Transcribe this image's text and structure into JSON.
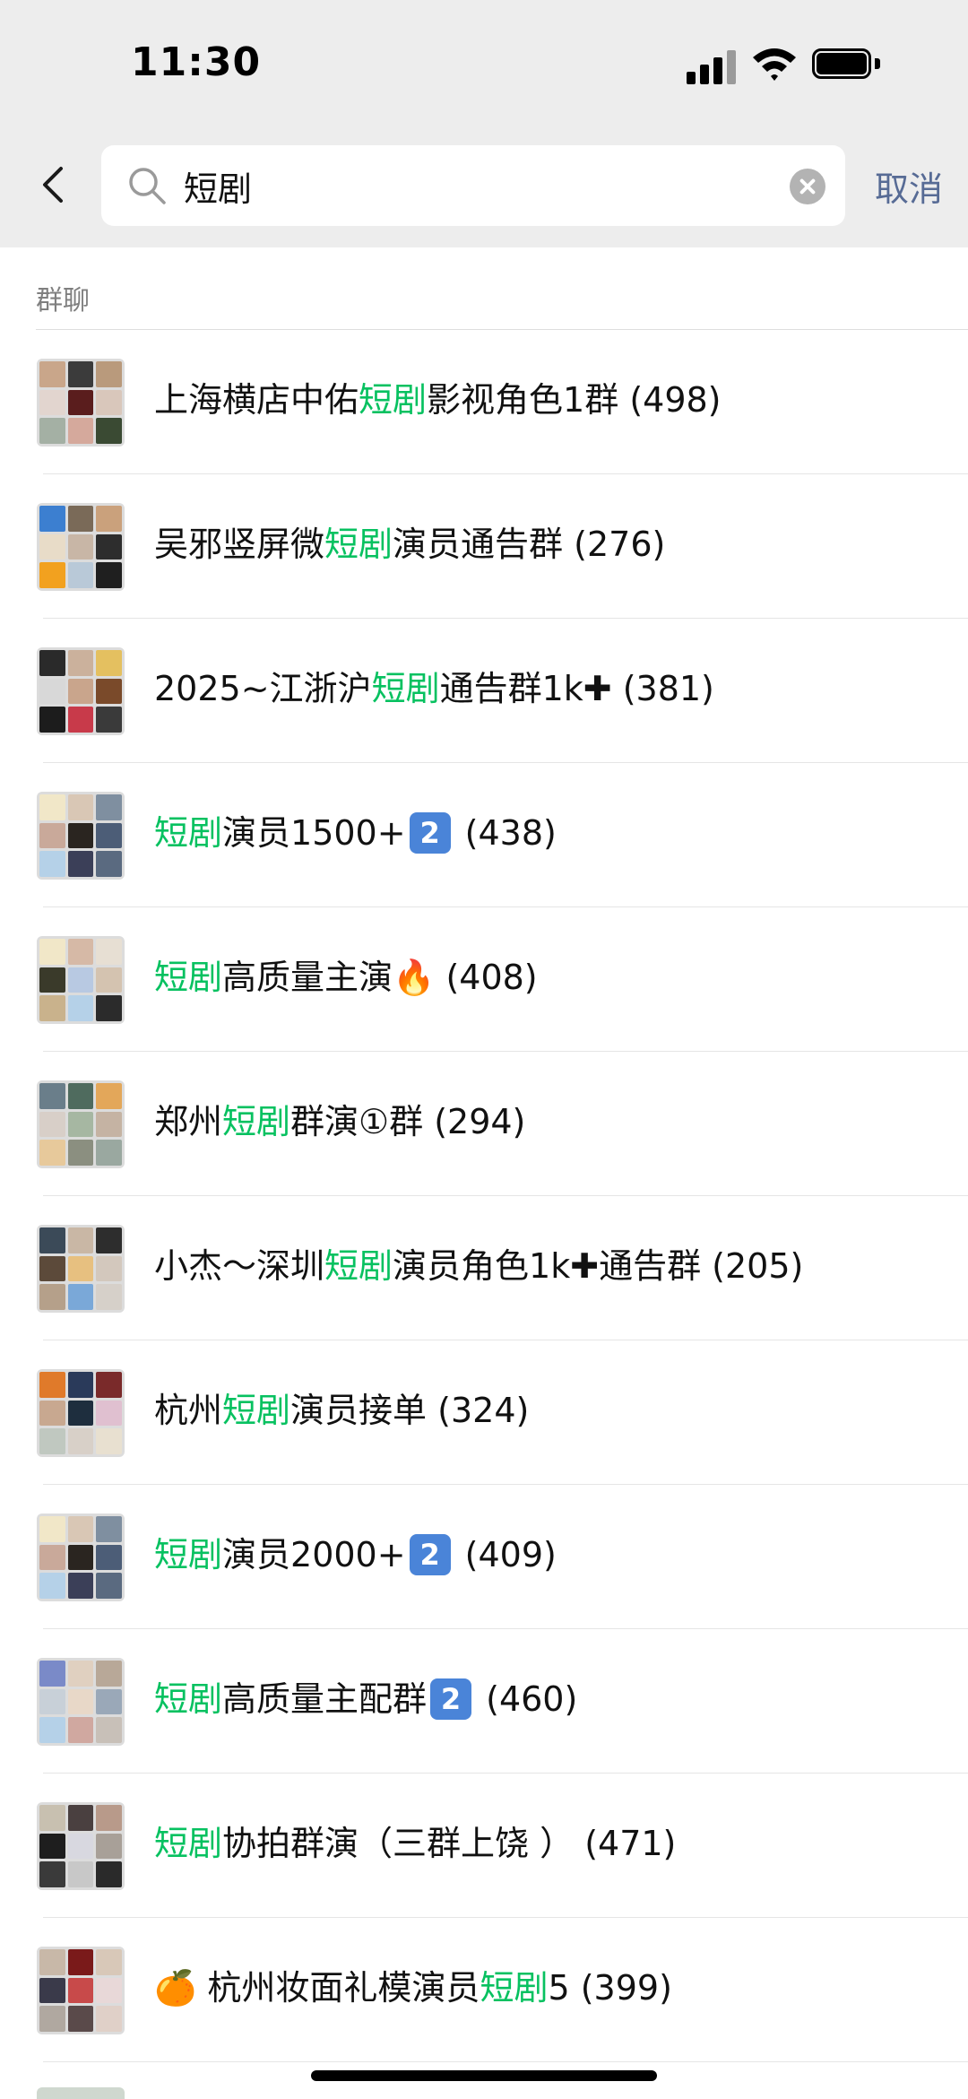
{
  "status_bar": {
    "time": "11:30"
  },
  "search": {
    "query": "短剧",
    "cancel_label": "取消"
  },
  "section": {
    "title": "群聊"
  },
  "results": [
    {
      "pre": "上海横店中佑",
      "hl": "短剧",
      "post": "影视角色1群",
      "count": "(498)",
      "avatar": [
        "#c9a68a",
        "#3b3b3b",
        "#b99a7c",
        "#e2d5cf",
        "#5a1d1d",
        "#d9c7bb",
        "#a4b0a4",
        "#d5a99c",
        "#3a4a33"
      ]
    },
    {
      "pre": "吴邪竖屏微",
      "hl": "短剧",
      "post": "演员通告群",
      "count": "(276)",
      "avatar": [
        "#3c7fd0",
        "#7a6a58",
        "#caa17c",
        "#e8dcc8",
        "#c8b6a6",
        "#2d2d2d",
        "#f2a11f",
        "#b9c9d8",
        "#1f1f1f"
      ]
    },
    {
      "pre": "2025~江浙沪",
      "hl": "短剧",
      "post": "通告群1k",
      "plus": "✚",
      "count": "(381)",
      "avatar": [
        "#2a2a2a",
        "#cbb19c",
        "#e4c060",
        "#d8d8d8",
        "#c9a58c",
        "#7a4a2a",
        "#1c1c1c",
        "#c83a4a",
        "#3a3a3a"
      ]
    },
    {
      "pre": "",
      "hl": "短剧",
      "post": "演员1500+",
      "badge": "2",
      "count": "(438)",
      "avatar": [
        "#f1e7c8",
        "#d9c7b5",
        "#7f8fa0",
        "#c9a99a",
        "#2a2520",
        "#4c5d77",
        "#b5d1e8",
        "#3b3f58",
        "#5a6a80"
      ]
    },
    {
      "pre": "",
      "hl": "短剧",
      "post": "高质量主演",
      "fire": "🔥",
      "count": "(408)",
      "avatar": [
        "#f1e7c8",
        "#d6b9a6",
        "#e7dfd3",
        "#3a3a2a",
        "#b8c9e2",
        "#d4c3b0",
        "#c9b28c",
        "#b5d1e8",
        "#2b2b2b"
      ]
    },
    {
      "pre": "郑州",
      "hl": "短剧",
      "post": "群演①群",
      "count": "(294)",
      "avatar": [
        "#6a7e8a",
        "#4f6b5e",
        "#e3a75a",
        "#d8cfc8",
        "#a6b7a2",
        "#c5b3a3",
        "#e7c99b",
        "#8b8f80",
        "#9aa8a0"
      ]
    },
    {
      "pre": "小杰～深圳",
      "hl": "短剧",
      "post": "演员角色1k",
      "plus": "✚",
      "post2": "通告群",
      "count": "(205)",
      "avatar": [
        "#3b4a58",
        "#c9b7a5",
        "#2d2d2d",
        "#5c4a3a",
        "#e7c080",
        "#d3c8bd",
        "#b5a08a",
        "#7aa8d8",
        "#d6d0c9"
      ]
    },
    {
      "pre": "杭州",
      "hl": "短剧",
      "post": "演员接单",
      "count": "(324)",
      "avatar": [
        "#e07a2a",
        "#2a3a5a",
        "#7a2a2a",
        "#c8a890",
        "#1e2e3e",
        "#e0c0d0",
        "#c0c8c0",
        "#d8d0c8",
        "#e8e0d0"
      ]
    },
    {
      "pre": "",
      "hl": "短剧",
      "post": "演员2000+",
      "badge": "2",
      "count": "(409)",
      "avatar": [
        "#f1e7c8",
        "#d9c7b5",
        "#7f8fa0",
        "#c9a99a",
        "#2a2520",
        "#4c5d77",
        "#b5d1e8",
        "#3b3f58",
        "#5a6a80"
      ]
    },
    {
      "pre": "",
      "hl": "短剧",
      "post": "高质量主配群",
      "badge": "2",
      "count": "(460)",
      "avatar": [
        "#7a8ac8",
        "#e0d0c0",
        "#b8a898",
        "#c8d0d8",
        "#e8d8c8",
        "#9aa8b8",
        "#b5d1e8",
        "#d0a8a0",
        "#c8c0b8"
      ]
    },
    {
      "pre": "",
      "hl": "短剧",
      "post": "协拍群演（三群上饶 ）",
      "count": "(471)",
      "avatar": [
        "#c8c0b0",
        "#4a4040",
        "#b89a8a",
        "#1e1e1e",
        "#d8d8e0",
        "#a8a098",
        "#3a3a3a",
        "#c8c8c8",
        "#2a2a2a"
      ]
    },
    {
      "lead": "🍊",
      "pre": "杭州妆面礼模演员",
      "hl": "短剧",
      "post": "5",
      "count": "(399)",
      "avatar": [
        "#c8b8a8",
        "#7a1a1a",
        "#d8c8b8",
        "#3a3a4a",
        "#c84a4a",
        "#e8d8d8",
        "#b0a8a0",
        "#5a4a4a",
        "#e0d0c8"
      ]
    }
  ]
}
